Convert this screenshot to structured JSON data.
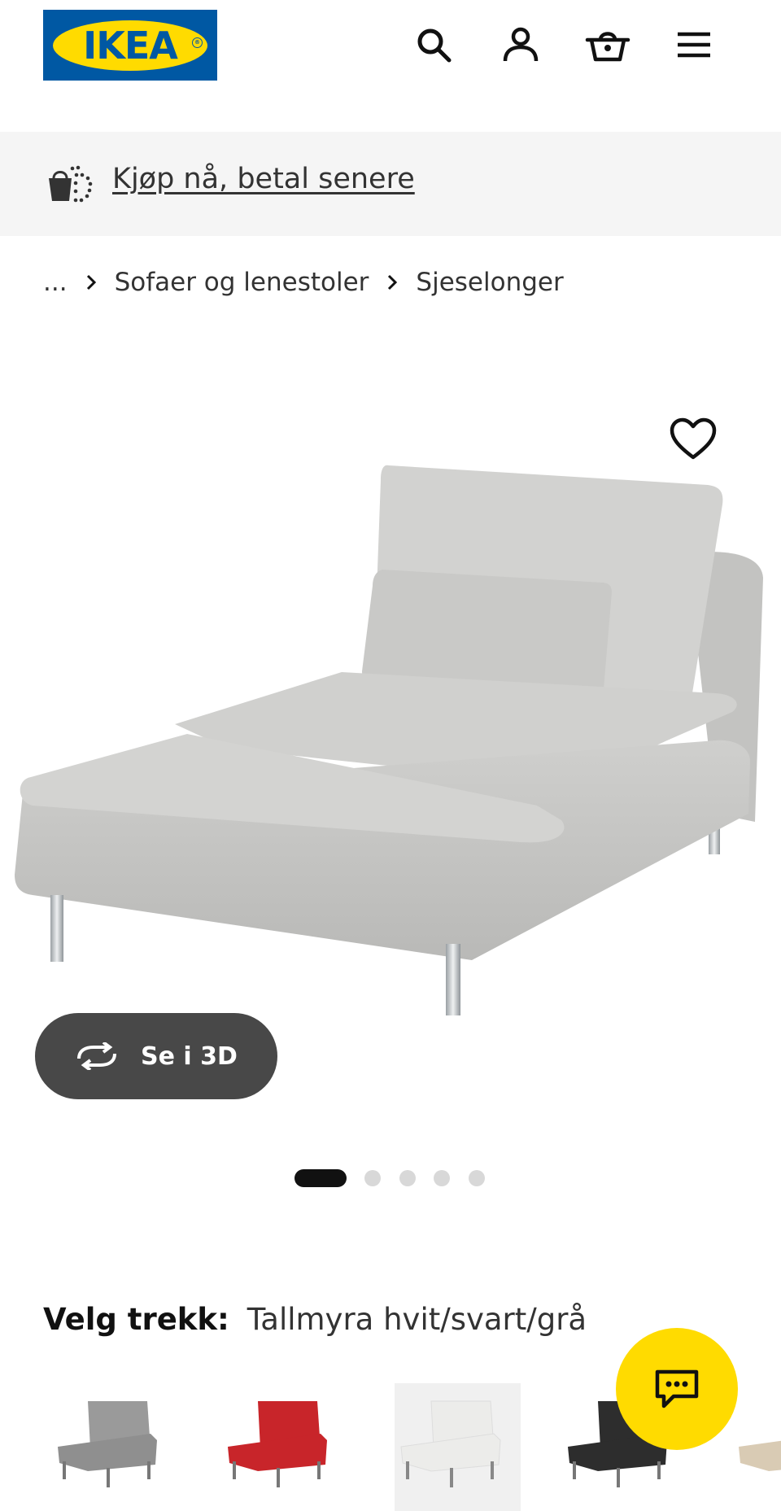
{
  "header": {
    "logo_text": "IKEA",
    "logo_registered": "®",
    "icons": [
      "search-icon",
      "user-icon",
      "cart-icon",
      "menu-icon"
    ],
    "brand_blue": "#0058a3",
    "brand_yellow": "#ffdb00"
  },
  "banner": {
    "link_text": "Kjøp nå, betal senere",
    "icon": "buy-now-pay-later-icon"
  },
  "breadcrumb": {
    "ellipsis": "...",
    "items": [
      "Sofaer og lenestoler",
      "Sjeselonger"
    ]
  },
  "product": {
    "image": "chaise-longue-light-grey",
    "favorite_icon": "heart-icon",
    "view3d_label": "Se i 3D",
    "carousel": {
      "count": 5,
      "active": 1
    }
  },
  "variant": {
    "label": "Velg trekk:",
    "value": "Tallmyra hvit/svart/grå",
    "options": [
      {
        "color": "#8f8f8f",
        "selected": false
      },
      {
        "color": "#c8252a",
        "selected": false
      },
      {
        "color": "#ececea",
        "selected": true
      },
      {
        "color": "#2d2d2d",
        "selected": false
      },
      {
        "color": "#d9cbb4",
        "selected": false
      }
    ]
  },
  "chat": {
    "icon": "chat-icon",
    "color": "#ffdb00"
  }
}
